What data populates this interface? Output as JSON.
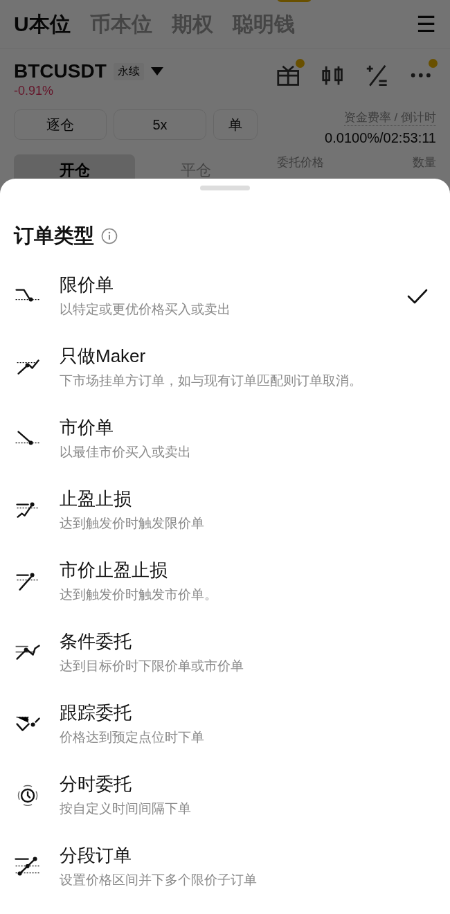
{
  "top_tabs": [
    {
      "label": "U本位",
      "selected": true
    },
    {
      "label": "币本位",
      "selected": false
    },
    {
      "label": "期权",
      "selected": false
    },
    {
      "label": "聪明钱",
      "selected": false
    }
  ],
  "menu_icon": "☰",
  "instrument": {
    "symbol": "BTCUSDT",
    "badge": "永续",
    "change": "-0.91%"
  },
  "toolbar_icons": [
    {
      "kind": "gift",
      "dot": true
    },
    {
      "kind": "candles",
      "dot": false
    },
    {
      "kind": "calc",
      "dot": false
    },
    {
      "kind": "more",
      "dot": true
    }
  ],
  "margin_buttons": [
    "逐仓",
    "5x",
    "单"
  ],
  "funding": {
    "label": "资金费率 / 倒计时",
    "value": "0.0100%/02:53:11"
  },
  "trade_tabs": [
    {
      "label": "开仓",
      "selected": true
    },
    {
      "label": "平仓",
      "selected": false
    }
  ],
  "book_columns": [
    "委托价格",
    "数量"
  ],
  "sheet": {
    "title": "订单类型",
    "options": [
      {
        "title": "限价单",
        "description": "以特定或更优价格买入或卖出",
        "selected": true
      },
      {
        "title": "只做Maker",
        "description": "下市场挂单方订单，如与现有订单匹配则订单取消。",
        "selected": false
      },
      {
        "title": "市价单",
        "description": "以最佳市价买入或卖出",
        "selected": false
      },
      {
        "title": "止盈止损",
        "description": "达到触发价时触发限价单",
        "selected": false
      },
      {
        "title": "市价止盈止损",
        "description": "达到触发价时触发市价单。",
        "selected": false
      },
      {
        "title": "条件委托",
        "description": "达到目标价时下限价单或市价单",
        "selected": false
      },
      {
        "title": "跟踪委托",
        "description": "价格达到预定点位时下单",
        "selected": false
      },
      {
        "title": "分时委托",
        "description": "按自定义时间间隔下单",
        "selected": false
      },
      {
        "title": "分段订单",
        "description": "设置价格区间并下多个限价子订单",
        "selected": false
      }
    ]
  }
}
